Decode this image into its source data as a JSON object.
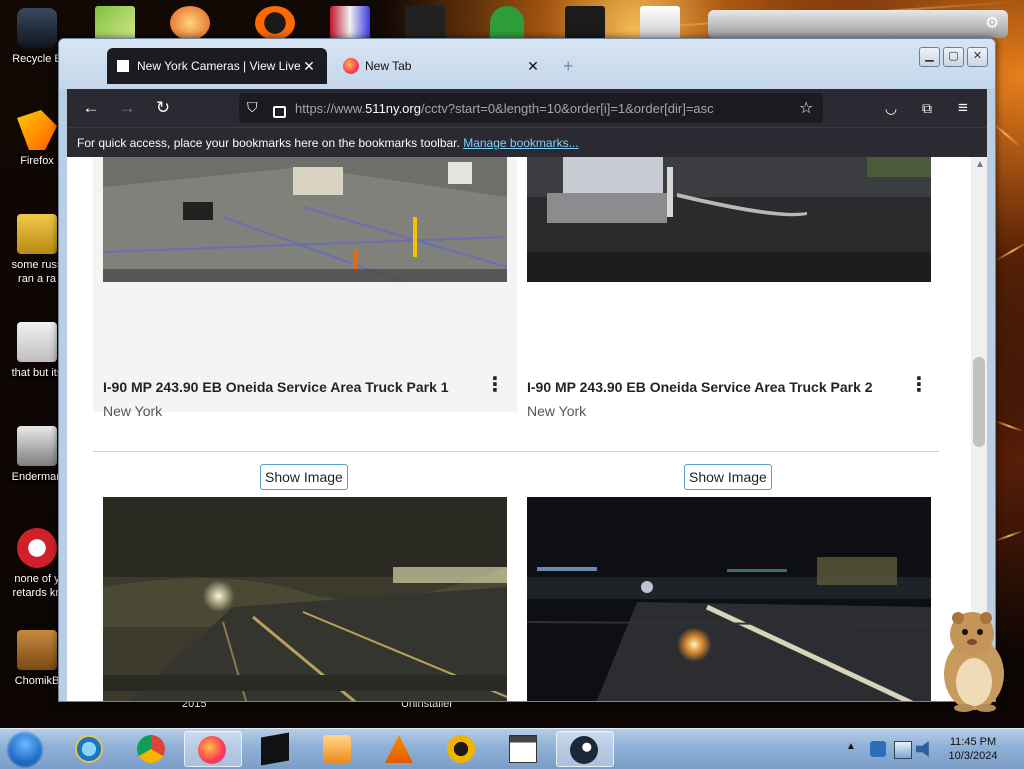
{
  "desktop": {
    "icons": [
      {
        "label": "Recycle B"
      },
      {
        "label": "Firefox"
      },
      {
        "label": "some russ"
      },
      {
        "label": "ran a ra"
      },
      {
        "label": "that but its"
      },
      {
        "label": "Enderman"
      },
      {
        "label": "none of y"
      },
      {
        "label": "retards kn"
      },
      {
        "label": "ChomikB"
      }
    ],
    "behind_labels": [
      "2015",
      "Uninstaller"
    ]
  },
  "browser": {
    "tabs": [
      {
        "title": "New York Cameras | View Live I",
        "active": true
      },
      {
        "title": "New Tab",
        "active": false
      }
    ],
    "new_tab_symbol": "+",
    "url": {
      "full": "https://www.511ny.org/cctv?start=0&length=10&order[i]=1&order[dir]=asc",
      "prefix": "https://www.",
      "domain": "511ny.org",
      "path": "/cctv?start=0&length=10&order[i]=1&order[dir]=asc"
    },
    "bookmarks_bar": {
      "message": "For quick access, place your bookmarks here on the bookmarks toolbar.",
      "link": "Manage bookmarks..."
    }
  },
  "page": {
    "cameras": [
      {
        "title": "I-90 MP 243.90 EB Oneida Service Area Truck Park 1",
        "region": "New York"
      },
      {
        "title": "I-90 MP 243.90 EB Oneida Service Area Truck Park 2",
        "region": "New York"
      }
    ],
    "show_image_label": "Show Image",
    "kebab_symbol": "⋮"
  },
  "taskbar": {
    "time": "11:45 PM",
    "date": "10/3/2024",
    "apps": [
      "internet-explorer",
      "chrome",
      "firefox",
      "black-box-app",
      "media-player",
      "vlc",
      "avast-like",
      "calendar-321",
      "steam"
    ]
  },
  "colors": {
    "browser_dark": "#2b2a33",
    "tab_active": "#1c1b22",
    "link": "#7dd3fc",
    "button_border": "#5aa0c9"
  }
}
